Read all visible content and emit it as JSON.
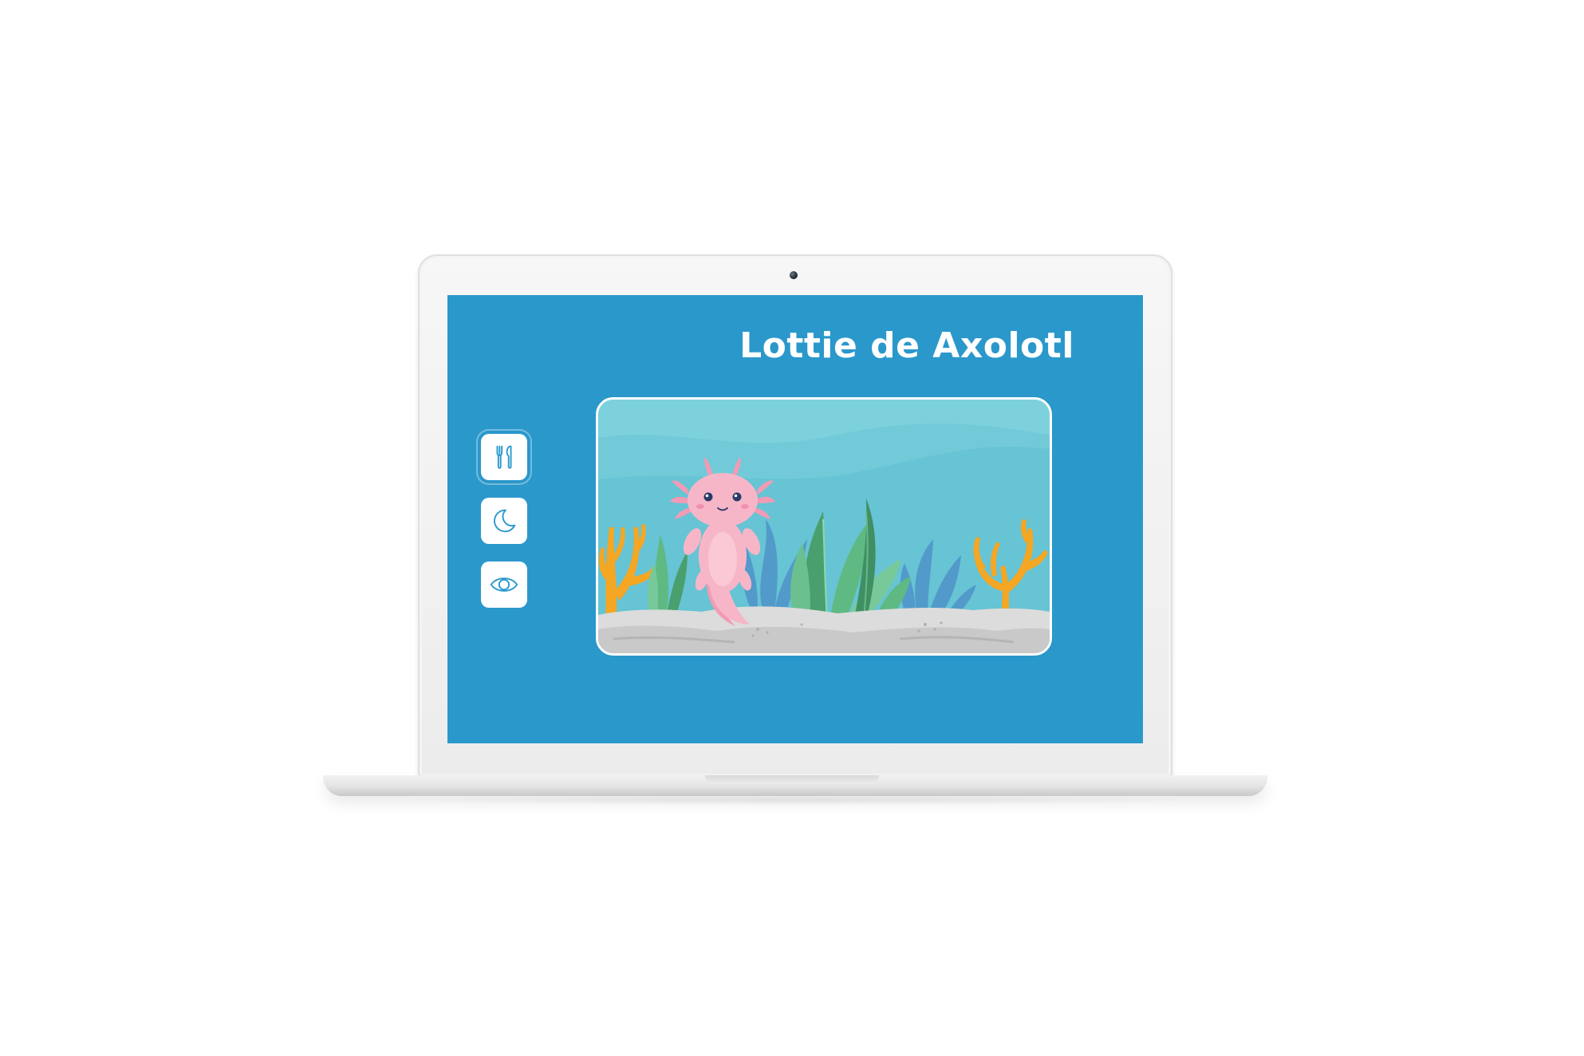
{
  "app": {
    "title": "Lottie de Axolotl"
  },
  "actions": [
    {
      "name": "feed",
      "icon": "fork-knife-icon"
    },
    {
      "name": "sleep",
      "icon": "moon-icon"
    },
    {
      "name": "watch",
      "icon": "eye-icon"
    }
  ],
  "theme": {
    "screen_bg": "#2a98cb",
    "icon_color": "#2a98cb",
    "tank_water": "#7dd1dc",
    "axolotl_pink": "#f7b6c8",
    "coral_orange": "#f5a623"
  }
}
